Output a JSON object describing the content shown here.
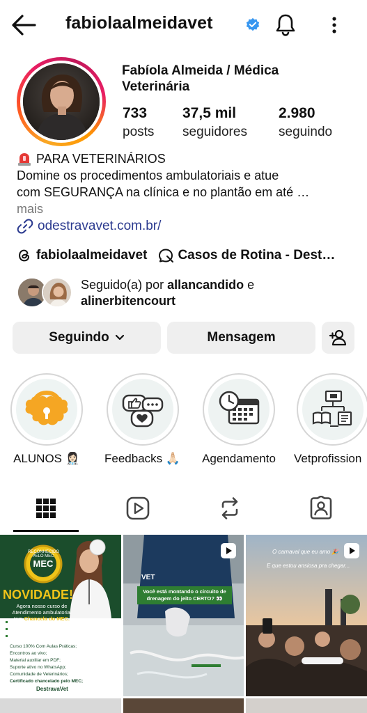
{
  "header": {
    "username": "fabiolaalmeidavet"
  },
  "profile": {
    "display_name": "Fabíola Almeida / Médica Veterinária",
    "stats": [
      {
        "value": "733",
        "label": "posts"
      },
      {
        "value": "37,5 mil",
        "label": "seguidores"
      },
      {
        "value": "2.980",
        "label": "seguindo"
      }
    ],
    "bio_title": "PARA VETERINÁRIOS",
    "bio_line1": "Domine os procedimentos ambulatoriais e atue",
    "bio_line2": "com SEGURANÇA na clínica e no plantão em até …",
    "bio_more": "mais",
    "website": "odestravavet.com.br/",
    "threads_handle": "fabiolaalmeidavet",
    "channel_name": "Casos de Rotina - Dest…",
    "followed_by_prefix": "Seguido(a) por ",
    "followed_by_user1": "allancandido",
    "followed_by_and": " e",
    "followed_by_user2": "alinerbitencourt"
  },
  "actions": {
    "following_label": "Seguindo",
    "message_label": "Mensagem"
  },
  "highlights": [
    {
      "label": "ALUNOS 👩🏻‍⚕️"
    },
    {
      "label": "Feedbacks 🙏🏻…"
    },
    {
      "label": "Agendamento"
    },
    {
      "label": "Vetprofission"
    }
  ],
  "posts": [
    {
      "badge": "RECONHECIDO PELO MEC",
      "badge_short": "MEC",
      "headline": "NOVIDADE!",
      "sub1": "Agora nosso curso de",
      "sub2": "Atendimento ambulatorial",
      "sub3": "tem",
      "sub3_highlight": "Chancela do MEC.",
      "bullets": [
        "Curso 100% Com Aulas Práticas;",
        "Encontros ao vivo;",
        "Material auxiliar em PDF;",
        "Suporte ativo no WhatsApp;",
        "Comunidade de Veterinários;",
        "Certificado chancelado pelo MEC;"
      ],
      "brand": "DestravaVet"
    },
    {
      "tag": "VET",
      "caption1": "Você está montando o circuito de",
      "caption2": "drenagem do jeito CERTO? 👀"
    },
    {
      "caption1": "O carnaval que eu amo 🎉",
      "caption2": "E que estou ansiosa pra chegar..."
    }
  ],
  "colors": {
    "accent_blue": "#3897f0",
    "link_blue": "#2b3a8f",
    "button_gray": "#efefef",
    "mec_green": "#1f5d34",
    "highlight_orange": "#f5a623"
  }
}
